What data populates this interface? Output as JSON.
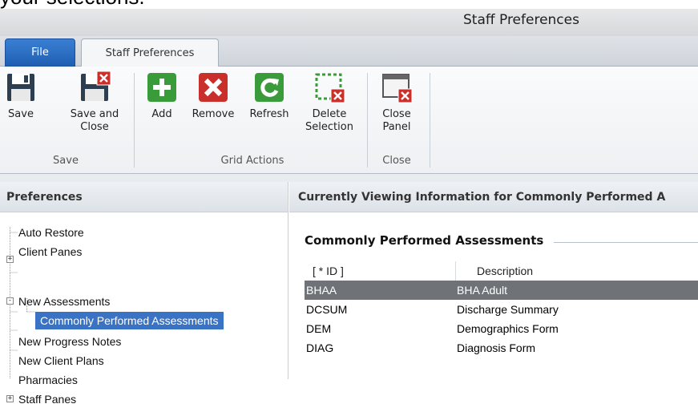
{
  "caption_fragment": "your selections.",
  "window": {
    "title": "Staff Preferences"
  },
  "tabs": {
    "file": "File",
    "staff_preferences": "Staff Preferences"
  },
  "ribbon": {
    "save_group": {
      "label": "Save",
      "buttons": [
        {
          "label": "Save",
          "icon": "floppy-disk-icon"
        },
        {
          "label": "Save and\nClose",
          "icon": "floppy-disk-close-icon"
        }
      ]
    },
    "grid_actions_group": {
      "label": "Grid Actions",
      "buttons": [
        {
          "label": "Add",
          "icon": "add-green-plus-icon"
        },
        {
          "label": "Remove",
          "icon": "remove-red-x-icon"
        },
        {
          "label": "Refresh",
          "icon": "refresh-green-icon"
        },
        {
          "label": "Delete\nSelection",
          "icon": "delete-selection-icon"
        }
      ]
    },
    "close_group": {
      "label": "Close",
      "buttons": [
        {
          "label": "Close\nPanel",
          "icon": "close-panel-icon"
        }
      ]
    }
  },
  "left_panel": {
    "header": "Preferences",
    "tree": [
      {
        "label": "Auto Restore",
        "expander": ""
      },
      {
        "label": "Client Panes",
        "expander": "+"
      },
      {
        "label": "New Assessments",
        "expander": "-"
      },
      {
        "label": "Commonly Performed Assessments",
        "expander": "",
        "selected": true
      },
      {
        "label": "New Progress Notes",
        "expander": ""
      },
      {
        "label": "New Client Plans",
        "expander": ""
      },
      {
        "label": "Pharmacies",
        "expander": ""
      },
      {
        "label": "Staff Panes",
        "expander": "+"
      }
    ]
  },
  "right_panel": {
    "header": "Currently Viewing Information for Commonly Performed A",
    "section_title": "Commonly Performed Assessments",
    "grid": {
      "columns": [
        "[ * ID ]",
        "Description"
      ],
      "rows": [
        {
          "id": "BHAA",
          "description": "BHA Adult",
          "selected": true
        },
        {
          "id": "DCSUM",
          "description": "Discharge Summary"
        },
        {
          "id": "DEM",
          "description": "Demographics Form"
        },
        {
          "id": "DIAG",
          "description": "Diagnosis Form"
        }
      ]
    }
  },
  "colors": {
    "file_tab": "#2b6fc6",
    "tree_selection": "#3a73c4",
    "grid_selection": "#6f7378",
    "add_green": "#3a9b3a",
    "remove_red": "#c9302c"
  }
}
